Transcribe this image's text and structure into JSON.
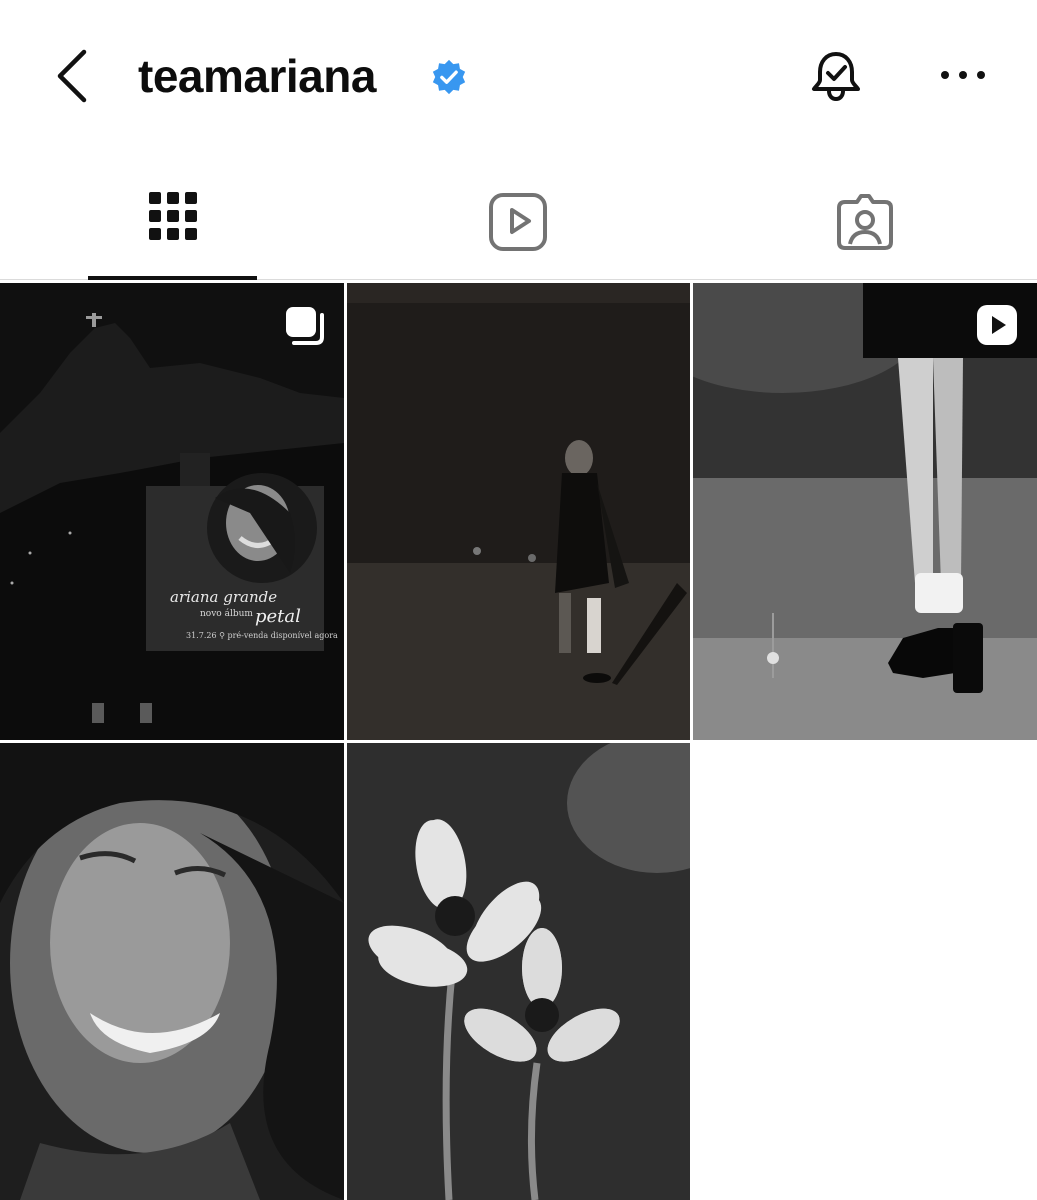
{
  "header": {
    "username": "teamariana",
    "verified": true,
    "back_icon": "chevron-left-icon",
    "bell_icon": "bell-check-icon",
    "more_icon": "more-horizontal-icon"
  },
  "tabs": [
    {
      "name": "posts",
      "icon": "grid-icon",
      "active": true
    },
    {
      "name": "reels",
      "icon": "reels-icon",
      "active": false
    },
    {
      "name": "tagged",
      "icon": "tagged-icon",
      "active": false
    }
  ],
  "posts": [
    {
      "type": "carousel",
      "badge_icon": "carousel-icon",
      "poster": {
        "title": "ariana grande",
        "subtitle": "novo álbum",
        "album": "petal",
        "date_line": "31.7.26  ⚲  pré-venda disponível agora"
      }
    },
    {
      "type": "photo"
    },
    {
      "type": "reel",
      "badge_icon": "play-badge-icon"
    },
    {
      "type": "photo"
    },
    {
      "type": "photo"
    }
  ],
  "colors": {
    "verified_blue": "#3897f0",
    "tab_active": "#111111",
    "tab_inactive": "#737373",
    "divider": "#dbdbdb"
  }
}
